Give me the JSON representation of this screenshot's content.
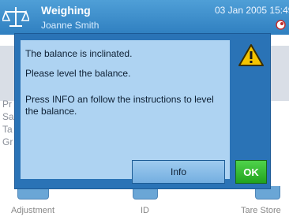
{
  "header": {
    "title": "Weighing",
    "user": "Joanne Smith",
    "datetime": "03 Jan 2005 15:49",
    "app_icon": "balance-scale-icon",
    "status_icon": "leveling-bubble-icon"
  },
  "background": {
    "letters": [
      "Pr",
      "Sa",
      "Ta",
      "Gr"
    ]
  },
  "softkeys": [
    {
      "label": "Adjustment"
    },
    {
      "label": "ID"
    },
    {
      "label": "Tare Store"
    }
  ],
  "dialog": {
    "line1": "The balance is inclinated.",
    "line2": "Please level the balance.",
    "line3": "Press INFO an follow the instructions to level the balance.",
    "info_label": "Info",
    "ok_label": "OK",
    "warning_icon": "warning-triangle-icon"
  },
  "colors": {
    "header": "#2f7fc0",
    "dialog_frame": "#2a73b6",
    "dialog_panel": "#aed3f2",
    "warning": "#f5c400",
    "ok_button": "#22a31e"
  }
}
